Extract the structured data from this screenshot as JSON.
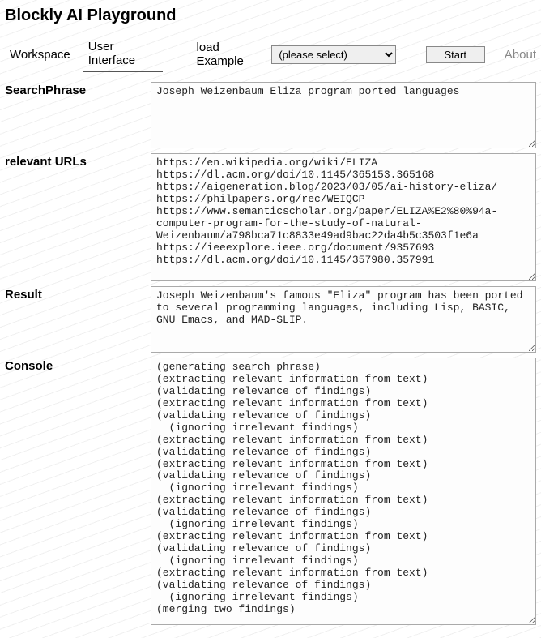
{
  "title": "Blockly AI Playground",
  "toolbar": {
    "tab_workspace": "Workspace",
    "tab_ui": "User Interface",
    "load_example_label": "load Example",
    "select_placeholder": "(please select)",
    "start_label": "Start",
    "about_label": "About"
  },
  "fields": {
    "search": {
      "label": "SearchPhrase",
      "value": "Joseph Weizenbaum Eliza program ported languages"
    },
    "urls": {
      "label": "relevant URLs",
      "value": "https://en.wikipedia.org/wiki/ELIZA\nhttps://dl.acm.org/doi/10.1145/365153.365168\nhttps://aigeneration.blog/2023/03/05/ai-history-eliza/\nhttps://philpapers.org/rec/WEIQCP\nhttps://www.semanticscholar.org/paper/ELIZA%E2%80%94a-computer-program-for-the-study-of-natural-Weizenbaum/a798bca71c8833e49ad9bac22da4b5c3503f1e6a\nhttps://ieeexplore.ieee.org/document/9357693\nhttps://dl.acm.org/doi/10.1145/357980.357991"
    },
    "result": {
      "label": "Result",
      "value": "Joseph Weizenbaum's famous \"Eliza\" program has been ported to several programming languages, including Lisp, BASIC, GNU Emacs, and MAD-SLIP."
    },
    "console": {
      "label": "Console",
      "value": "(generating search phrase)\n(extracting relevant information from text)\n(validating relevance of findings)\n(extracting relevant information from text)\n(validating relevance of findings)\n  (ignoring irrelevant findings)\n(extracting relevant information from text)\n(validating relevance of findings)\n(extracting relevant information from text)\n(validating relevance of findings)\n  (ignoring irrelevant findings)\n(extracting relevant information from text)\n(validating relevance of findings)\n  (ignoring irrelevant findings)\n(extracting relevant information from text)\n(validating relevance of findings)\n  (ignoring irrelevant findings)\n(extracting relevant information from text)\n(validating relevance of findings)\n  (ignoring irrelevant findings)\n(merging two findings)"
    }
  }
}
